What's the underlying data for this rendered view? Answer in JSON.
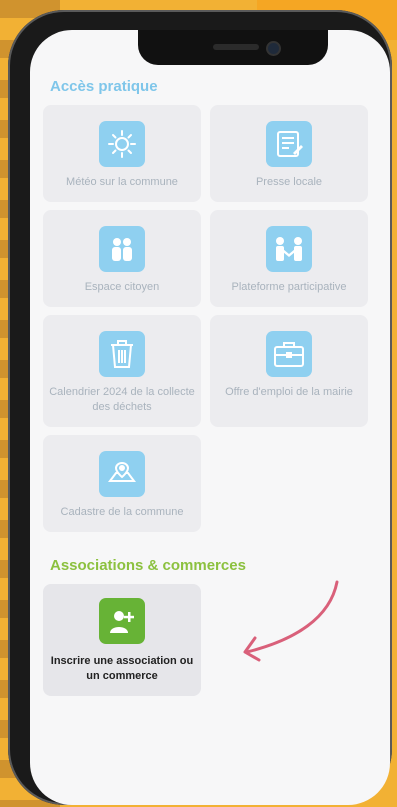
{
  "sections": {
    "acces_pratique": "Accès pratique",
    "associations": "Associations & commerces"
  },
  "tiles": [
    {
      "label": "Météo sur la commune",
      "icon": "sun-icon"
    },
    {
      "label": "Presse locale",
      "icon": "newspaper-icon"
    },
    {
      "label": "Espace citoyen",
      "icon": "citizens-icon"
    },
    {
      "label": "Plateforme participative",
      "icon": "handshake-icon"
    },
    {
      "label": "Calendrier 2024 de la collecte des déchets",
      "icon": "trash-icon"
    },
    {
      "label": "Offre d'emploi de la mairie",
      "icon": "briefcase-icon"
    },
    {
      "label": "Cadastre de la commune",
      "icon": "map-icon"
    }
  ],
  "assoc_tile": {
    "label": "Inscrire une association ou un commerce",
    "icon": "add-user-icon"
  },
  "colors": {
    "section_blue": "#7fc6ea",
    "section_green": "#8cc13f",
    "tile_icon_blue": "#8fd0f0",
    "assoc_icon_green": "#67b336",
    "arrow_pink": "#d9607a"
  }
}
